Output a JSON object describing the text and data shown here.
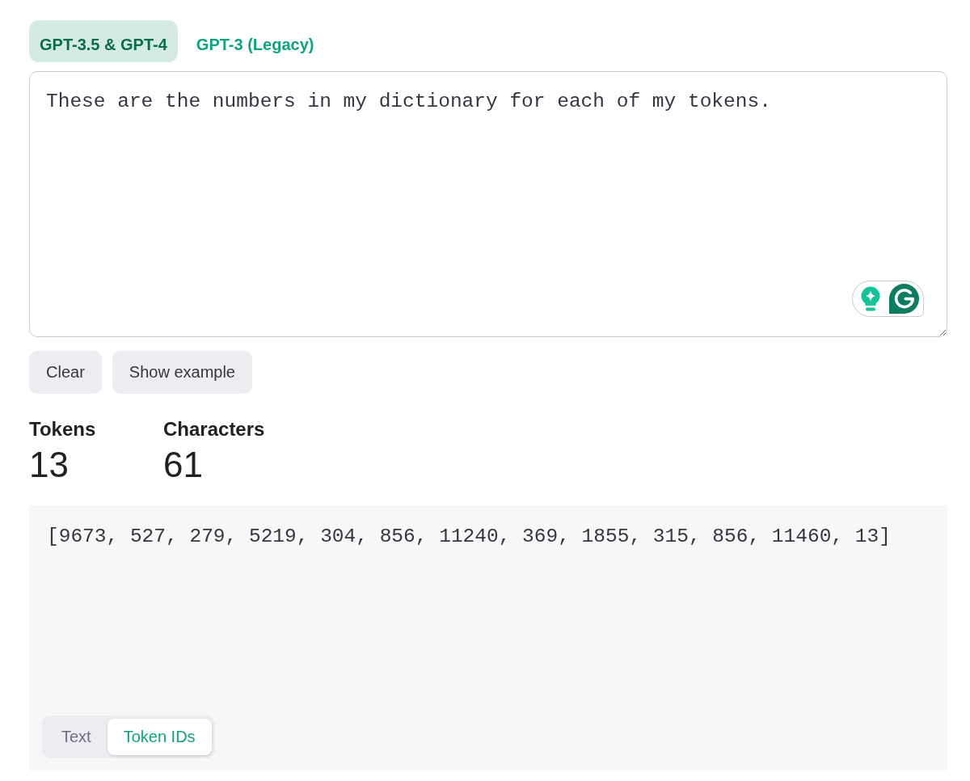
{
  "model_tabs": [
    {
      "label": "GPT-3.5 & GPT-4",
      "selected": true
    },
    {
      "label": "GPT-3 (Legacy)",
      "selected": false
    }
  ],
  "input": {
    "value": "These are the numbers in my dictionary for each of my tokens."
  },
  "buttons": [
    "Clear",
    "Show example"
  ],
  "stats": [
    {
      "label": "Tokens",
      "value": "13"
    },
    {
      "label": "Characters",
      "value": "61"
    }
  ],
  "output": {
    "text": "[9673, 527, 279, 5219, 304, 856, 11240, 369, 1855, 315, 856, 11460, 13]",
    "view_tabs": [
      {
        "label": "Text",
        "selected": false
      },
      {
        "label": "Token IDs",
        "selected": true
      }
    ]
  }
}
